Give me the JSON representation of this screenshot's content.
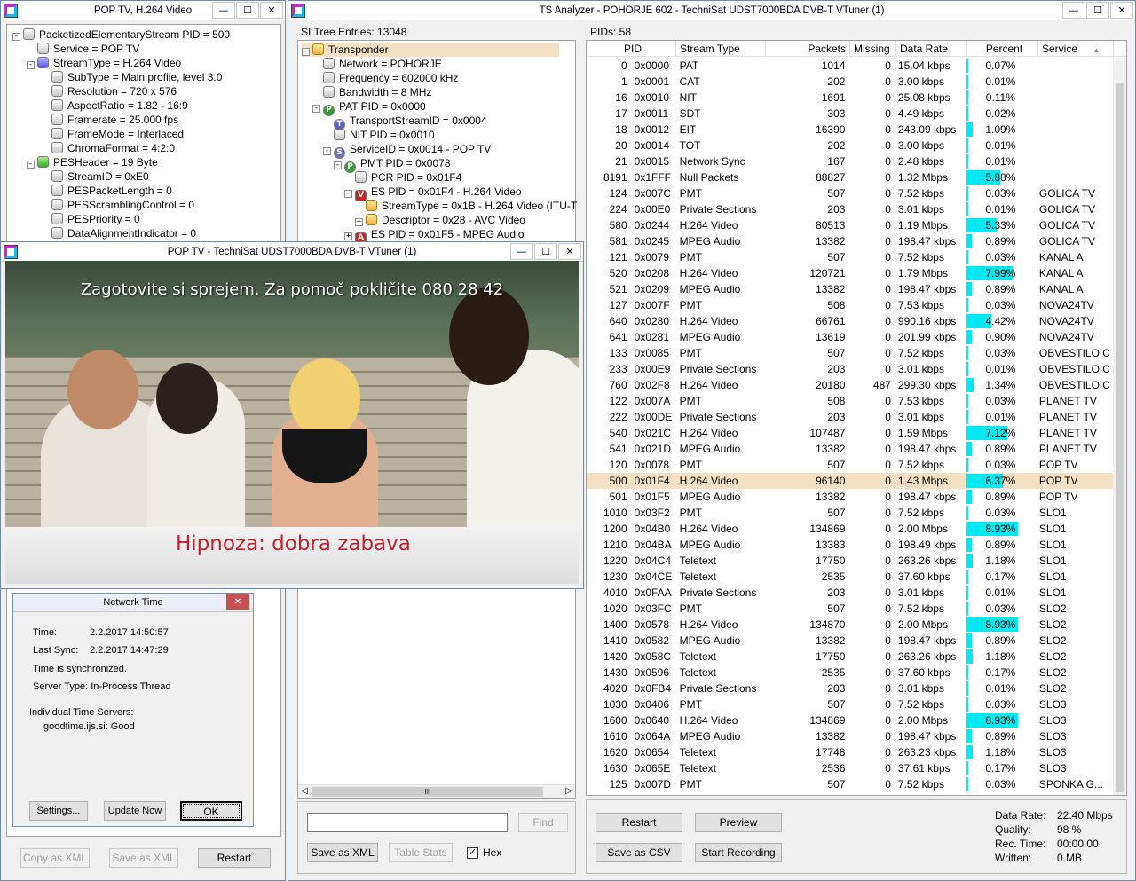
{
  "pes_window": {
    "title": "POP TV, H.264 Video",
    "tree": [
      {
        "label": "PacketizedElementaryStream PID = 500",
        "level": 0,
        "exp": "-",
        "icon": "gray"
      },
      {
        "label": "Service = POP TV",
        "level": 1,
        "exp": "",
        "icon": "gray"
      },
      {
        "label": "StreamType = H.264 Video",
        "level": 1,
        "exp": "-",
        "icon": "blue"
      },
      {
        "label": "SubType = Main profile, level 3.0",
        "level": 2,
        "exp": "",
        "icon": "gray"
      },
      {
        "label": "Resolution = 720 x 576",
        "level": 2,
        "exp": "",
        "icon": "gray"
      },
      {
        "label": "AspectRatio = 1.82 - 16:9",
        "level": 2,
        "exp": "",
        "icon": "gray"
      },
      {
        "label": "Framerate = 25.000 fps",
        "level": 2,
        "exp": "",
        "icon": "gray"
      },
      {
        "label": "FrameMode = Interlaced",
        "level": 2,
        "exp": "",
        "icon": "gray"
      },
      {
        "label": "ChromaFormat = 4:2:0",
        "level": 2,
        "exp": "",
        "icon": "gray"
      },
      {
        "label": "PESHeader = 19 Byte",
        "level": 1,
        "exp": "-",
        "icon": "green"
      },
      {
        "label": "StreamID = 0xE0",
        "level": 2,
        "exp": "",
        "icon": "gray"
      },
      {
        "label": "PESPacketLength = 0",
        "level": 2,
        "exp": "",
        "icon": "gray"
      },
      {
        "label": "PESScramblingControl = 0",
        "level": 2,
        "exp": "",
        "icon": "gray"
      },
      {
        "label": "PESPriority = 0",
        "level": 2,
        "exp": "",
        "icon": "gray"
      },
      {
        "label": "DataAlignmentIndicator = 0",
        "level": 2,
        "exp": "",
        "icon": "gray"
      }
    ],
    "copy_xml": "Copy as XML",
    "save_xml": "Save as XML",
    "restart": "Restart"
  },
  "network_time": {
    "title": "Network Time",
    "close": "✕",
    "time_label": "Time:",
    "time_value": "2.2.2017 14:50:57",
    "sync_label": "Last Sync:",
    "sync_value": "2.2.2017 14:47:29",
    "status": "Time is synchronized.",
    "server_type": "Server Type: In-Process Thread",
    "servers_label": "Individual Time Servers:",
    "server_entry": "goodtime.ijs.si: Good",
    "settings": "Settings...",
    "update": "Update Now",
    "ok": "OK"
  },
  "video_window": {
    "title": "POP TV - TechniSat UDST7000BDA DVB-T VTuner (1)",
    "subtitle_top": "Zagotovite si sprejem. Za pomoč pokličite 080 28 42",
    "subtitle_bottom": "Hipnoza: dobra zabava"
  },
  "main_window": {
    "title": "TS Analyzer - POHORJE 602 - TechniSat UDST7000BDA DVB-T VTuner (1)",
    "si_header": "SI Tree Entries: 13048",
    "si_tree": [
      {
        "label": "Transponder",
        "level": 0,
        "exp": "-",
        "icon": "folder",
        "sel": true
      },
      {
        "label": "Network = POHORJE",
        "level": 1,
        "exp": "",
        "icon": "gray"
      },
      {
        "label": "Frequency = 602000 kHz",
        "level": 1,
        "exp": "",
        "icon": "gray"
      },
      {
        "label": "Bandwidth = 8 MHz",
        "level": 1,
        "exp": "",
        "icon": "gray"
      },
      {
        "label": "PAT PID = 0x0000",
        "level": 1,
        "exp": "-",
        "icon": "P"
      },
      {
        "label": "TransportStreamID = 0x0004",
        "level": 2,
        "exp": "",
        "icon": "gray"
      },
      {
        "label": "NIT PID = 0x0010",
        "level": 2,
        "exp": "",
        "icon": "gray"
      },
      {
        "label": "ServiceID = 0x0014 - POP TV",
        "level": 2,
        "exp": "-",
        "icon": "S"
      },
      {
        "label": "PMT PID = 0x0078",
        "level": 3,
        "exp": "-",
        "icon": "P"
      },
      {
        "label": "PCR PID = 0x01F4",
        "level": 4,
        "exp": "",
        "icon": "gray"
      },
      {
        "label": "ES PID = 0x01F4 - H.264 Video",
        "level": 4,
        "exp": "-",
        "icon": "V"
      },
      {
        "label": "StreamType = 0x1B - H.264 Video (ITU-T",
        "level": 5,
        "exp": "",
        "icon": "folder"
      },
      {
        "label": "Descriptor = 0x28 - AVC Video",
        "level": 5,
        "exp": "+",
        "icon": "folder"
      },
      {
        "label": "ES PID = 0x01F5 - MPEG Audio",
        "level": 4,
        "exp": "+",
        "icon": "A"
      }
    ],
    "tree_icon_T": "T",
    "find_placeholder": "",
    "find": "Find",
    "save_xml": "Save as XML",
    "table_stats": "Table Stats",
    "hex": "Hex",
    "pids_header": "PIDs: 58",
    "columns": [
      "PID",
      "Stream Type",
      "Packets",
      "Missing",
      "Data Rate",
      "Percent",
      "Service"
    ],
    "sort_arrow": "▲",
    "rows": [
      [
        "0",
        "0x0000",
        "PAT",
        "1014",
        "0",
        "15.04 kbps",
        "0.07%",
        "",
        0.07
      ],
      [
        "1",
        "0x0001",
        "CAT",
        "202",
        "0",
        "3.00 kbps",
        "0.01%",
        "",
        0.01
      ],
      [
        "16",
        "0x0010",
        "NIT",
        "1691",
        "0",
        "25.08 kbps",
        "0.11%",
        "",
        0.11
      ],
      [
        "17",
        "0x0011",
        "SDT",
        "303",
        "0",
        "4.49 kbps",
        "0.02%",
        "",
        0.02
      ],
      [
        "18",
        "0x0012",
        "EIT",
        "16390",
        "0",
        "243.09 kbps",
        "1.09%",
        "",
        1.09
      ],
      [
        "20",
        "0x0014",
        "TOT",
        "202",
        "0",
        "3.00 kbps",
        "0.01%",
        "",
        0.01
      ],
      [
        "21",
        "0x0015",
        "Network Sync",
        "167",
        "0",
        "2.48 kbps",
        "0.01%",
        "",
        0.01
      ],
      [
        "8191",
        "0x1FFF",
        "Null Packets",
        "88827",
        "0",
        "1.32 Mbps",
        "5.88%",
        "",
        5.88
      ],
      [
        "124",
        "0x007C",
        "PMT",
        "507",
        "0",
        "7.52 kbps",
        "0.03%",
        "GOLICA TV",
        0.03
      ],
      [
        "224",
        "0x00E0",
        "Private Sections",
        "203",
        "0",
        "3.01 kbps",
        "0.01%",
        "GOLICA TV",
        0.01
      ],
      [
        "580",
        "0x0244",
        "H.264 Video",
        "80513",
        "0",
        "1.19 Mbps",
        "5.33%",
        "GOLICA TV",
        5.33
      ],
      [
        "581",
        "0x0245",
        "MPEG Audio",
        "13382",
        "0",
        "198.47 kbps",
        "0.89%",
        "GOLICA TV",
        0.89
      ],
      [
        "121",
        "0x0079",
        "PMT",
        "507",
        "0",
        "7.52 kbps",
        "0.03%",
        "KANAL A",
        0.03
      ],
      [
        "520",
        "0x0208",
        "H.264 Video",
        "120721",
        "0",
        "1.79 Mbps",
        "7.99%",
        "KANAL A",
        7.99
      ],
      [
        "521",
        "0x0209",
        "MPEG Audio",
        "13382",
        "0",
        "198.47 kbps",
        "0.89%",
        "KANAL A",
        0.89
      ],
      [
        "127",
        "0x007F",
        "PMT",
        "508",
        "0",
        "7.53 kbps",
        "0.03%",
        "NOVA24TV",
        0.03
      ],
      [
        "640",
        "0x0280",
        "H.264 Video",
        "66761",
        "0",
        "990.16 kbps",
        "4.42%",
        "NOVA24TV",
        4.42
      ],
      [
        "641",
        "0x0281",
        "MPEG Audio",
        "13619",
        "0",
        "201.99 kbps",
        "0.90%",
        "NOVA24TV",
        0.9
      ],
      [
        "133",
        "0x0085",
        "PMT",
        "507",
        "0",
        "7.52 kbps",
        "0.03%",
        "OBVESTILO C",
        0.03
      ],
      [
        "233",
        "0x00E9",
        "Private Sections",
        "203",
        "0",
        "3.01 kbps",
        "0.01%",
        "OBVESTILO C",
        0.01
      ],
      [
        "760",
        "0x02F8",
        "H.264 Video",
        "20180",
        "487",
        "299.30 kbps",
        "1.34%",
        "OBVESTILO C",
        1.34
      ],
      [
        "122",
        "0x007A",
        "PMT",
        "508",
        "0",
        "7.53 kbps",
        "0.03%",
        "PLANET TV",
        0.03
      ],
      [
        "222",
        "0x00DE",
        "Private Sections",
        "203",
        "0",
        "3.01 kbps",
        "0.01%",
        "PLANET TV",
        0.01
      ],
      [
        "540",
        "0x021C",
        "H.264 Video",
        "107487",
        "0",
        "1.59 Mbps",
        "7.12%",
        "PLANET TV",
        7.12
      ],
      [
        "541",
        "0x021D",
        "MPEG Audio",
        "13382",
        "0",
        "198.47 kbps",
        "0.89%",
        "PLANET TV",
        0.89
      ],
      [
        "120",
        "0x0078",
        "PMT",
        "507",
        "0",
        "7.52 kbps",
        "0.03%",
        "POP TV",
        0.03
      ],
      [
        "500",
        "0x01F4",
        "H.264 Video",
        "96140",
        "0",
        "1.43 Mbps",
        "6.37%",
        "POP TV",
        6.37
      ],
      [
        "501",
        "0x01F5",
        "MPEG Audio",
        "13382",
        "0",
        "198.47 kbps",
        "0.89%",
        "POP TV",
        0.89
      ],
      [
        "1010",
        "0x03F2",
        "PMT",
        "507",
        "0",
        "7.52 kbps",
        "0.03%",
        "SLO1",
        0.03
      ],
      [
        "1200",
        "0x04B0",
        "H.264 Video",
        "134869",
        "0",
        "2.00 Mbps",
        "8.93%",
        "SLO1",
        8.93
      ],
      [
        "1210",
        "0x04BA",
        "MPEG Audio",
        "13383",
        "0",
        "198.49 kbps",
        "0.89%",
        "SLO1",
        0.89
      ],
      [
        "1220",
        "0x04C4",
        "Teletext",
        "17750",
        "0",
        "263.26 kbps",
        "1.18%",
        "SLO1",
        1.18
      ],
      [
        "1230",
        "0x04CE",
        "Teletext",
        "2535",
        "0",
        "37.60 kbps",
        "0.17%",
        "SLO1",
        0.17
      ],
      [
        "4010",
        "0x0FAA",
        "Private Sections",
        "203",
        "0",
        "3.01 kbps",
        "0.01%",
        "SLO1",
        0.01
      ],
      [
        "1020",
        "0x03FC",
        "PMT",
        "507",
        "0",
        "7.52 kbps",
        "0.03%",
        "SLO2",
        0.03
      ],
      [
        "1400",
        "0x0578",
        "H.264 Video",
        "134870",
        "0",
        "2.00 Mbps",
        "8.93%",
        "SLO2",
        8.93
      ],
      [
        "1410",
        "0x0582",
        "MPEG Audio",
        "13382",
        "0",
        "198.47 kbps",
        "0.89%",
        "SLO2",
        0.89
      ],
      [
        "1420",
        "0x058C",
        "Teletext",
        "17750",
        "0",
        "263.26 kbps",
        "1.18%",
        "SLO2",
        1.18
      ],
      [
        "1430",
        "0x0596",
        "Teletext",
        "2535",
        "0",
        "37.60 kbps",
        "0.17%",
        "SLO2",
        0.17
      ],
      [
        "4020",
        "0x0FB4",
        "Private Sections",
        "203",
        "0",
        "3.01 kbps",
        "0.01%",
        "SLO2",
        0.01
      ],
      [
        "1030",
        "0x0406",
        "PMT",
        "507",
        "0",
        "7.52 kbps",
        "0.03%",
        "SLO3",
        0.03
      ],
      [
        "1600",
        "0x0640",
        "H.264 Video",
        "134869",
        "0",
        "2.00 Mbps",
        "8.93%",
        "SLO3",
        8.93
      ],
      [
        "1610",
        "0x064A",
        "MPEG Audio",
        "13382",
        "0",
        "198.47 kbps",
        "0.89%",
        "SLO3",
        0.89
      ],
      [
        "1620",
        "0x0654",
        "Teletext",
        "17748",
        "0",
        "263.23 kbps",
        "1.18%",
        "SLO3",
        1.18
      ],
      [
        "1630",
        "0x065E",
        "Teletext",
        "2536",
        "0",
        "37.61 kbps",
        "0.17%",
        "SLO3",
        0.17
      ],
      [
        "125",
        "0x007D",
        "PMT",
        "507",
        "0",
        "7.52 kbps",
        "0.03%",
        "SPONKA G...",
        0.03
      ]
    ],
    "selected_row": 26,
    "restart": "Restart",
    "preview": "Preview",
    "save_csv": "Save as CSV",
    "start_recording": "Start Recording",
    "stats": [
      {
        "label": "Data Rate:",
        "value": "22.40 Mbps"
      },
      {
        "label": "Quality:",
        "value": "98 %"
      },
      {
        "label": "Rec. Time:",
        "value": "00:00:00"
      },
      {
        "label": "Written:",
        "value": "0 MB"
      }
    ]
  },
  "window_buttons": {
    "min": "—",
    "max": "☐",
    "close": "✕"
  },
  "colors": {
    "percent_bar": "#00e8f0",
    "selected_row": "#f4e0c4"
  }
}
